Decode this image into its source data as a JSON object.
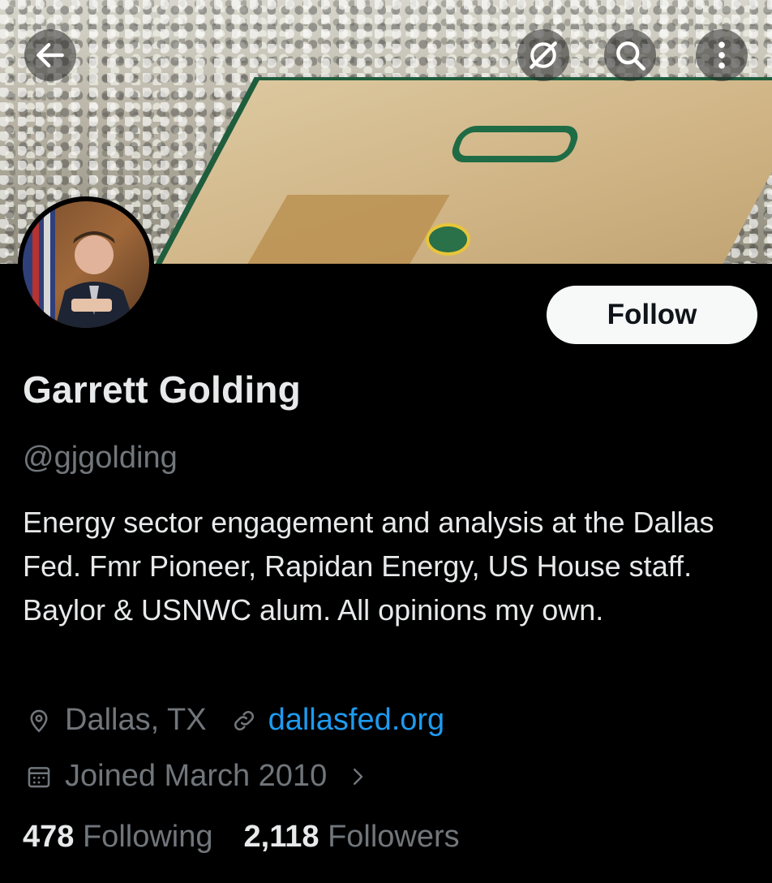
{
  "banner": {
    "description_icon_actions": {
      "back_icon": "back-arrow-icon",
      "grok_icon": "grok-icon",
      "search_icon": "search-icon",
      "more_icon": "more-vertical-icon"
    }
  },
  "profile": {
    "name": "Garrett Golding",
    "handle": "@gjgolding",
    "bio": "Energy sector engagement and analysis at the Dallas Fed. Fmr Pioneer, Rapidan Energy, US House staff. Baylor & USNWC alum. All opinions my own.",
    "location": "Dallas, TX",
    "website": "dallasfed.org",
    "joined": "Joined March 2010",
    "follow_label": "Follow"
  },
  "stats": {
    "following_count": "478",
    "following_label": "Following",
    "followers_count": "2,118",
    "followers_label": "Followers"
  },
  "colors": {
    "background": "#000000",
    "primary_text": "#e7e9ea",
    "secondary_text": "#71767b",
    "link": "#1d9bf0",
    "follow_button_bg": "#f7f9f9"
  }
}
